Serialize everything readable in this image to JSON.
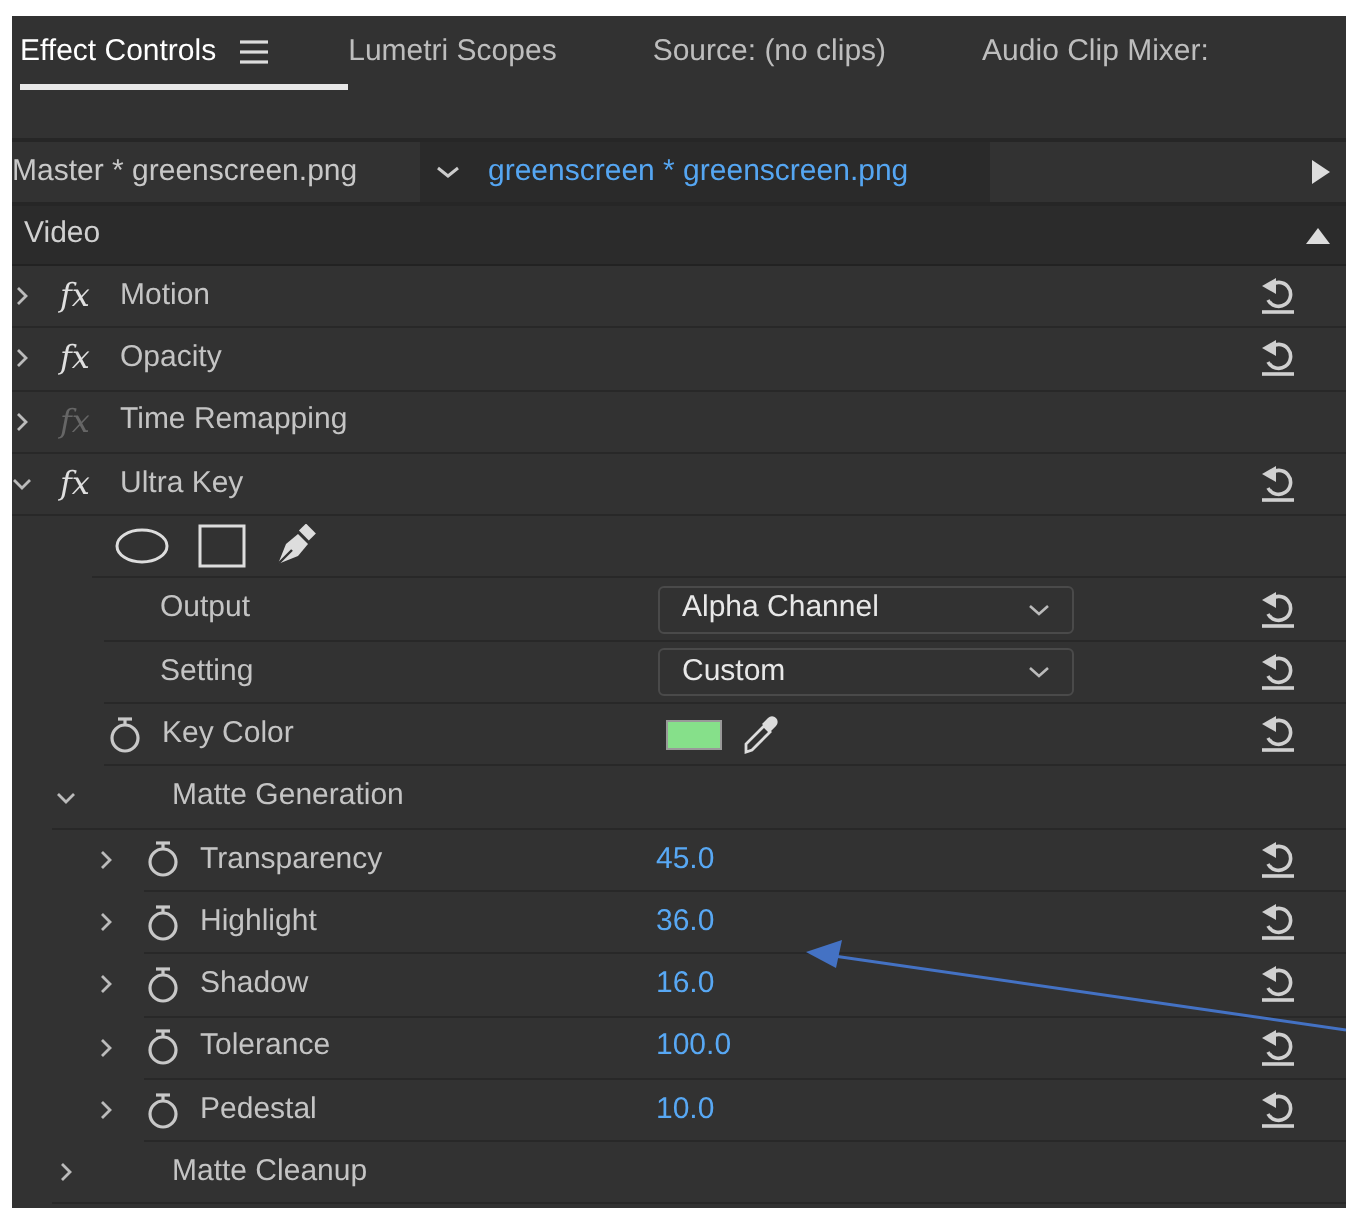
{
  "tabs": [
    {
      "label": "Effect Controls",
      "selected": true,
      "menu": true
    },
    {
      "label": "Lumetri Scopes",
      "selected": false,
      "menu": false
    },
    {
      "label": "Source: (no clips)",
      "selected": false,
      "menu": false
    },
    {
      "label": "Audio Clip Mixer:",
      "selected": false,
      "menu": false
    }
  ],
  "clip_bar": {
    "master": "Master * greenscreen.png",
    "clip": "greenscreen * greenscreen.png"
  },
  "section": {
    "label": "Video",
    "expanded": true
  },
  "effects": [
    {
      "name": "Motion",
      "badge": "fx",
      "fx_enabled": true,
      "expanded": false,
      "reset": true
    },
    {
      "name": "Opacity",
      "badge": "fx",
      "fx_enabled": true,
      "expanded": false,
      "reset": true
    },
    {
      "name": "Time Remapping",
      "badge": "fx",
      "fx_enabled": false,
      "expanded": false,
      "reset": false
    },
    {
      "name": "Ultra Key",
      "badge": "fx",
      "fx_enabled": true,
      "expanded": true,
      "reset": true,
      "children": [
        {
          "kind": "mask_tools"
        },
        {
          "kind": "dropdown",
          "label": "Output",
          "value": "Alpha Channel"
        },
        {
          "kind": "dropdown",
          "label": "Setting",
          "value": "Custom"
        },
        {
          "kind": "color",
          "label": "Key Color",
          "color": "#86e08a"
        },
        {
          "kind": "group",
          "label": "Matte Generation",
          "expanded": true,
          "children": [
            {
              "kind": "number",
              "label": "Transparency",
              "value": "45.0",
              "expanded": false
            },
            {
              "kind": "number",
              "label": "Highlight",
              "value": "36.0",
              "expanded": false
            },
            {
              "kind": "number",
              "label": "Shadow",
              "value": "16.0",
              "expanded": false
            },
            {
              "kind": "number",
              "label": "Tolerance",
              "value": "100.0",
              "expanded": false
            },
            {
              "kind": "number",
              "label": "Pedestal",
              "value": "10.0",
              "expanded": false
            }
          ]
        },
        {
          "kind": "group",
          "label": "Matte Cleanup",
          "expanded": false
        }
      ]
    }
  ]
}
